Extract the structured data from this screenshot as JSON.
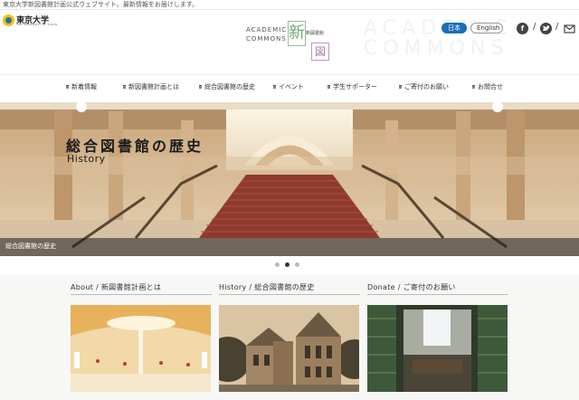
{
  "topbar": {
    "text": "東京大学新図書館計画公式ウェブサイト。最新情報をお届けします。"
  },
  "header": {
    "ut_logo": {
      "name": "東京大学",
      "sub": "THE UNIVERSITY OF TOKYO"
    },
    "ac_logo": {
      "line1": "ACADEMIC",
      "line2": "COMMONS",
      "shin": "新",
      "zu": "図",
      "lib": "新図書館"
    },
    "ghost_line1": "ACADEMIC",
    "ghost_line2": "COMMONS",
    "lang_ja": "日本語",
    "lang_en": "English",
    "icons": [
      "facebook-icon",
      "twitter-icon",
      "mail-icon"
    ]
  },
  "nav": [
    "新着情報",
    "新図書館計画とは",
    "総合図書館の歴史",
    "イベント",
    "学生サポーター",
    "ご寄付のお願い",
    "お問合せ"
  ],
  "hero": {
    "title": "総合図書館の歴史",
    "subtitle": "History",
    "caption": "総合図書館の歴史",
    "slides": 3,
    "active_slide": 2
  },
  "cards": [
    {
      "heading": "About / 新図書館計画とは"
    },
    {
      "heading": "History / 総合図書館の歴史"
    },
    {
      "heading": "Donate / ご寄付のお願い"
    }
  ],
  "colors": {
    "lang_active": "#1a6fb5",
    "dot_active": "#333333",
    "dot_idle": "#bbbbbb"
  }
}
